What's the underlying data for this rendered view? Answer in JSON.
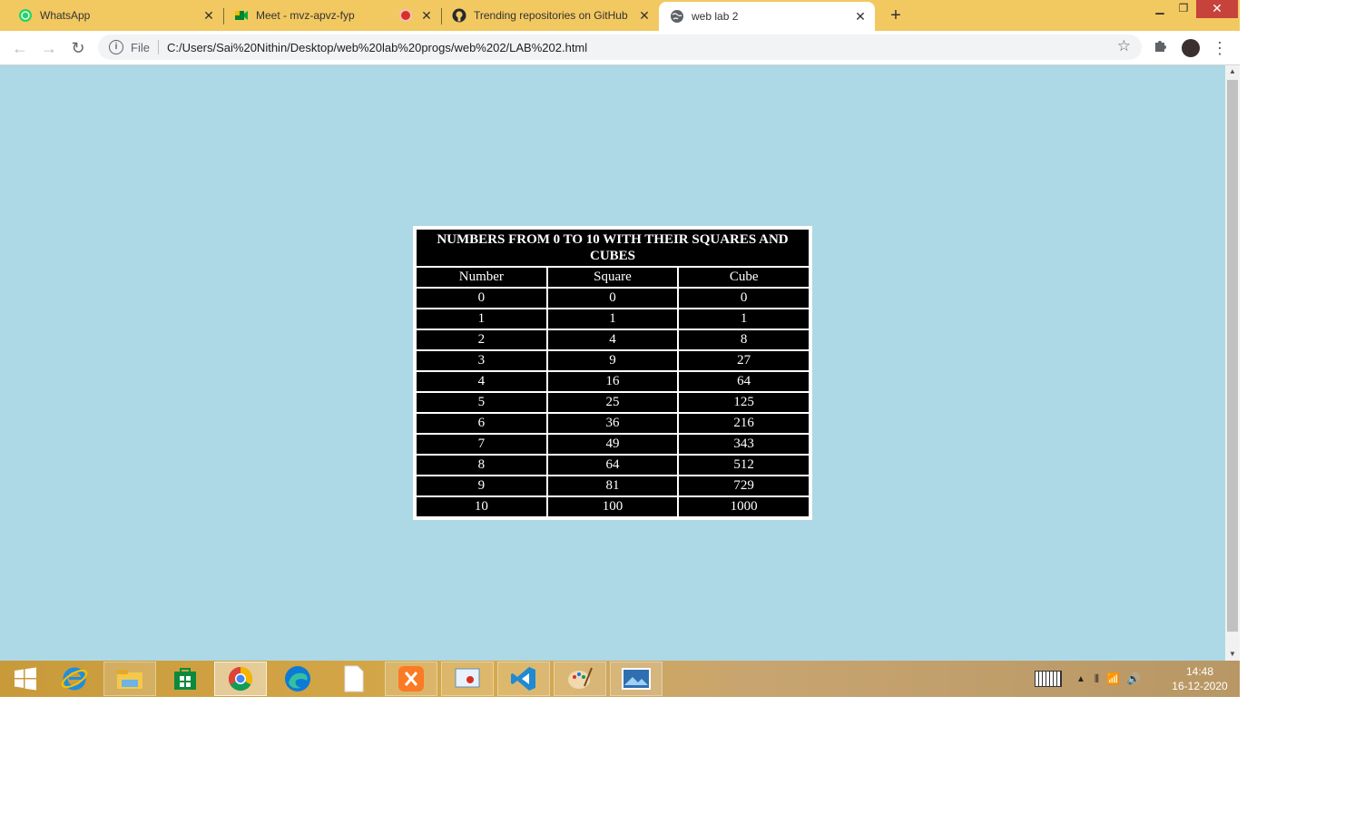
{
  "browser": {
    "tabs": [
      {
        "title": "WhatsApp",
        "icon": "whatsapp-icon",
        "active": false
      },
      {
        "title": "Meet - mvz-apvz-fyp",
        "icon": "meet-icon",
        "active": false,
        "recording": true
      },
      {
        "title": "Trending repositories on GitHub",
        "icon": "github-icon",
        "active": false
      },
      {
        "title": "web lab 2",
        "icon": "globe-icon",
        "active": true
      }
    ],
    "omnibox": {
      "scheme_label": "File",
      "url": "C:/Users/Sai%20Nithin/Desktop/web%20lab%20progs/web%202/LAB%202.html"
    }
  },
  "page": {
    "background": "#add8e6",
    "table": {
      "caption": "NUMBERS FROM 0 TO 10 WITH THEIR SQUARES AND CUBES",
      "headers": [
        "Number",
        "Square",
        "Cube"
      ],
      "rows": [
        [
          "0",
          "0",
          "0"
        ],
        [
          "1",
          "1",
          "1"
        ],
        [
          "2",
          "4",
          "8"
        ],
        [
          "3",
          "9",
          "27"
        ],
        [
          "4",
          "16",
          "64"
        ],
        [
          "5",
          "25",
          "125"
        ],
        [
          "6",
          "36",
          "216"
        ],
        [
          "7",
          "49",
          "343"
        ],
        [
          "8",
          "64",
          "512"
        ],
        [
          "9",
          "81",
          "729"
        ],
        [
          "10",
          "100",
          "1000"
        ]
      ]
    }
  },
  "taskbar": {
    "apps": [
      "windows-start-icon",
      "internet-explorer-icon",
      "file-explorer-icon",
      "store-icon",
      "chrome-icon",
      "edge-icon",
      "notepad-icon",
      "xampp-icon",
      "snipping-icon",
      "vscode-icon",
      "paint-icon",
      "photos-icon"
    ],
    "clock_time": "14:48",
    "clock_date": "16-12-2020"
  }
}
